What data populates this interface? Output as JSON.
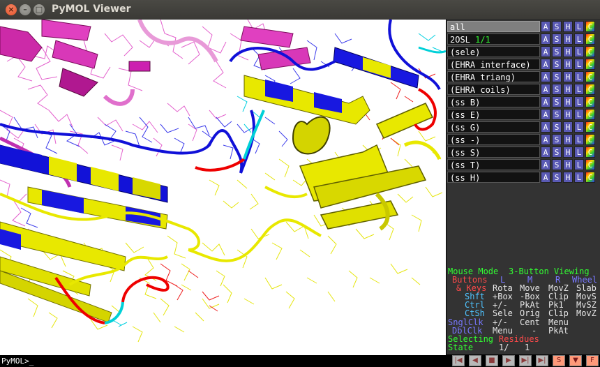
{
  "window": {
    "title": "PyMOL Viewer",
    "close_glyph": "×",
    "min_glyph": "–",
    "max_glyph": "□"
  },
  "command_line": {
    "prompt": "PyMOL>_"
  },
  "objects": [
    {
      "name": "all",
      "state": "",
      "active": true
    },
    {
      "name": "2OSL",
      "state": "1/1",
      "active": false
    },
    {
      "name": "(sele)",
      "state": "",
      "active": false
    },
    {
      "name": "(EHRA_interface)",
      "state": "",
      "active": false
    },
    {
      "name": "(EHRA_triang)",
      "state": "",
      "active": false
    },
    {
      "name": "(EHRA_coils)",
      "state": "",
      "active": false
    },
    {
      "name": "(ss_B)",
      "state": "",
      "active": false
    },
    {
      "name": "(ss_E)",
      "state": "",
      "active": false
    },
    {
      "name": "(ss_G)",
      "state": "",
      "active": false
    },
    {
      "name": "(ss_-)",
      "state": "",
      "active": false
    },
    {
      "name": "(ss_S)",
      "state": "",
      "active": false
    },
    {
      "name": "(ss_T)",
      "state": "",
      "active": false
    },
    {
      "name": "(ss_H)",
      "state": "",
      "active": false
    }
  ],
  "object_buttons": [
    "A",
    "S",
    "H",
    "L",
    "C"
  ],
  "mouse_panel": {
    "mode_label": "Mouse Mode",
    "mode_value": "3-Button Viewing",
    "buttons_label": "Buttons",
    "col_L": "L",
    "col_M": "M",
    "col_R": "R",
    "col_wheel": "Wheel",
    "keys_label": "& Keys",
    "keys_row": [
      "Rota",
      "Move",
      "MovZ",
      "Slab"
    ],
    "shft_label": "Shft",
    "shft_row": [
      "+Box",
      "-Box",
      "Clip",
      "MovS"
    ],
    "ctrl_label": "Ctrl",
    "ctrl_row": [
      "+/-",
      "PkAt",
      "Pk1",
      "MvSZ"
    ],
    "ctsh_label": "CtSh",
    "ctsh_row": [
      "Sele",
      "Orig",
      "Clip",
      "MovZ"
    ],
    "snglclk_label": "SnglClk",
    "snglclk_row": [
      "+/-",
      "Cent",
      "Menu",
      ""
    ],
    "dblclk_label": "DblClk",
    "dblclk_row": [
      "Menu",
      "-",
      "PkAt",
      ""
    ],
    "selecting_label": "Selecting",
    "selecting_value": "Residues",
    "state_label": "State",
    "state_value": "1/",
    "state_total": "1"
  },
  "player_buttons": [
    {
      "icon": "rewind-icon",
      "glyph": "|◀"
    },
    {
      "icon": "step-back-icon",
      "glyph": "◀"
    },
    {
      "icon": "stop-icon",
      "glyph": "■"
    },
    {
      "icon": "play-icon",
      "glyph": "▶"
    },
    {
      "icon": "step-forward-icon",
      "glyph": "▶|"
    },
    {
      "icon": "fast-forward-icon",
      "glyph": "▶|"
    },
    {
      "icon": "sculpt-icon",
      "glyph": "S"
    },
    {
      "icon": "menu-down-icon",
      "glyph": "▼"
    },
    {
      "icon": "fullscreen-icon",
      "glyph": "F"
    }
  ],
  "colors": {
    "chain_magenta": "#e040c0",
    "chain_blue": "#0a0ad8",
    "chain_yellow": "#e8e800",
    "coil_red": "#ee0000",
    "coil_cyan": "#00d8d8",
    "background": "#ffffff"
  }
}
